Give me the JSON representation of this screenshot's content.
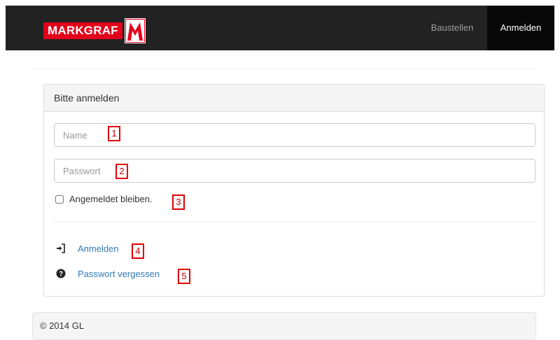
{
  "header": {
    "brand_text": "MARKGRAF",
    "brand_color": "#e2001a",
    "nav": [
      {
        "label": "Baustellen",
        "active": false
      },
      {
        "label": "Anmelden",
        "active": true
      }
    ]
  },
  "login_panel": {
    "title": "Bitte anmelden",
    "name_placeholder": "Name",
    "password_placeholder": "Passwort",
    "remember_label": "Angemeldet bleiben.",
    "remember_checked": false,
    "login_link": "Anmelden",
    "login_icon": "sign-in-icon",
    "forgot_link": "Passwort vergessen",
    "forgot_icon": "question-circle-icon"
  },
  "annotations": [
    "1",
    "2",
    "3",
    "4",
    "5"
  ],
  "footer": {
    "text": "© 2014 GL"
  }
}
